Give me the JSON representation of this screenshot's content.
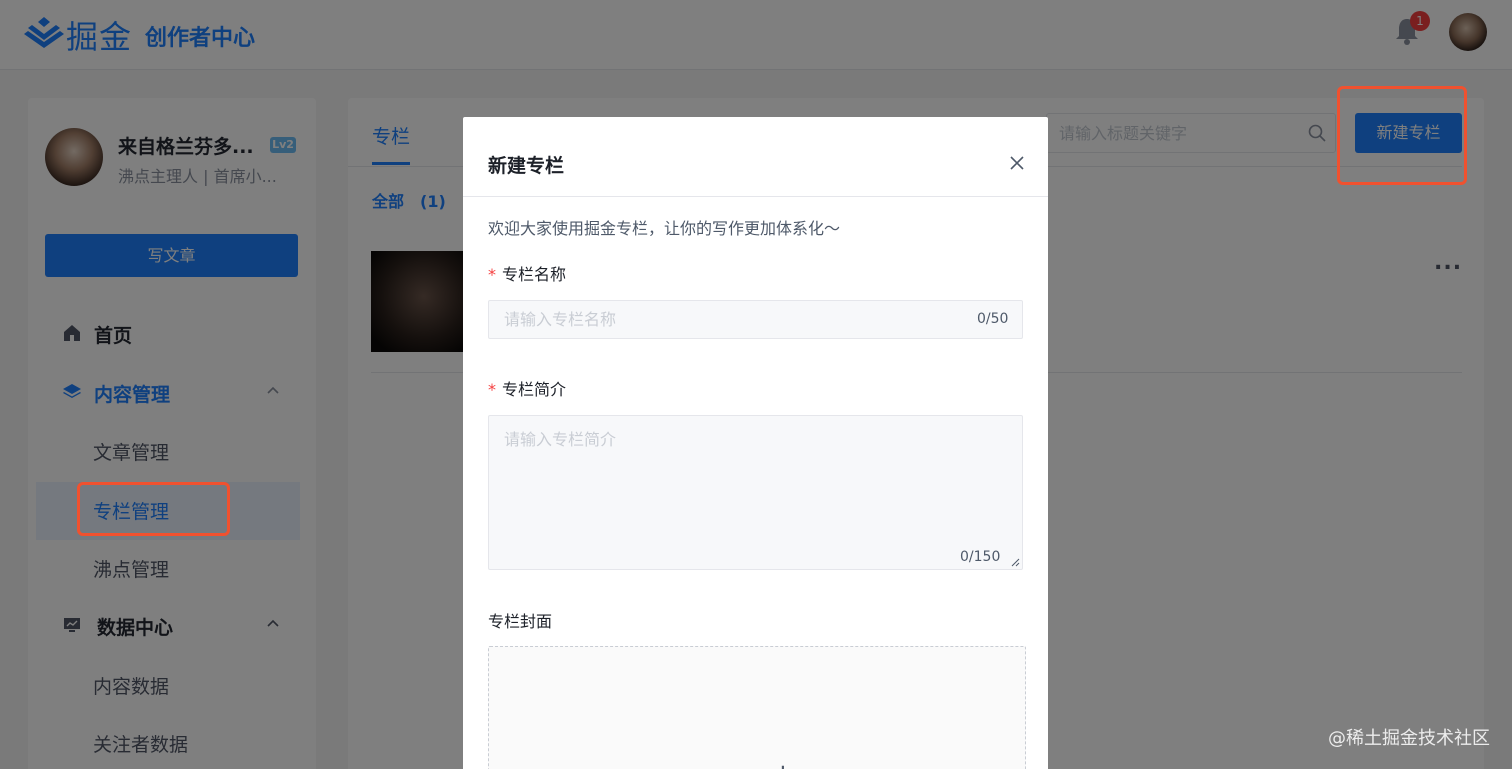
{
  "header": {
    "logo_text": "掘金",
    "center_title": "创作者中心",
    "notification_count": "1"
  },
  "sidebar": {
    "user_name": "来自格兰芬多...",
    "user_level": "Lv2",
    "user_desc": "沸点主理人 | 首席小...",
    "write_button": "写文章",
    "items": [
      {
        "label": "首页"
      },
      {
        "label": "内容管理"
      },
      {
        "label": "文章管理"
      },
      {
        "label": "专栏管理"
      },
      {
        "label": "沸点管理"
      },
      {
        "label": "数据中心"
      },
      {
        "label": "内容数据"
      },
      {
        "label": "关注者数据"
      }
    ]
  },
  "main": {
    "tab_label": "专栏",
    "filter_label": "全部　(1)",
    "search_placeholder": "请输入标题关键字",
    "new_column_button": "新建专栏",
    "more_label": "..."
  },
  "modal": {
    "title": "新建专栏",
    "intro": "欢迎大家使用掘金专栏，让你的写作更加体系化～",
    "name_label": "专栏名称",
    "name_placeholder": "请输入专栏名称",
    "name_counter": "0/50",
    "intro_label": "专栏简介",
    "intro_placeholder": "请输入专栏简介",
    "intro_counter": "0/150",
    "cover_label": "专栏封面",
    "upload_plus": "+",
    "required_mark": "*"
  },
  "watermark": "@稀土掘金技术社区",
  "colors": {
    "brand": "#1e80ff",
    "annotation": "#f0512f",
    "danger": "#f53f3f"
  }
}
